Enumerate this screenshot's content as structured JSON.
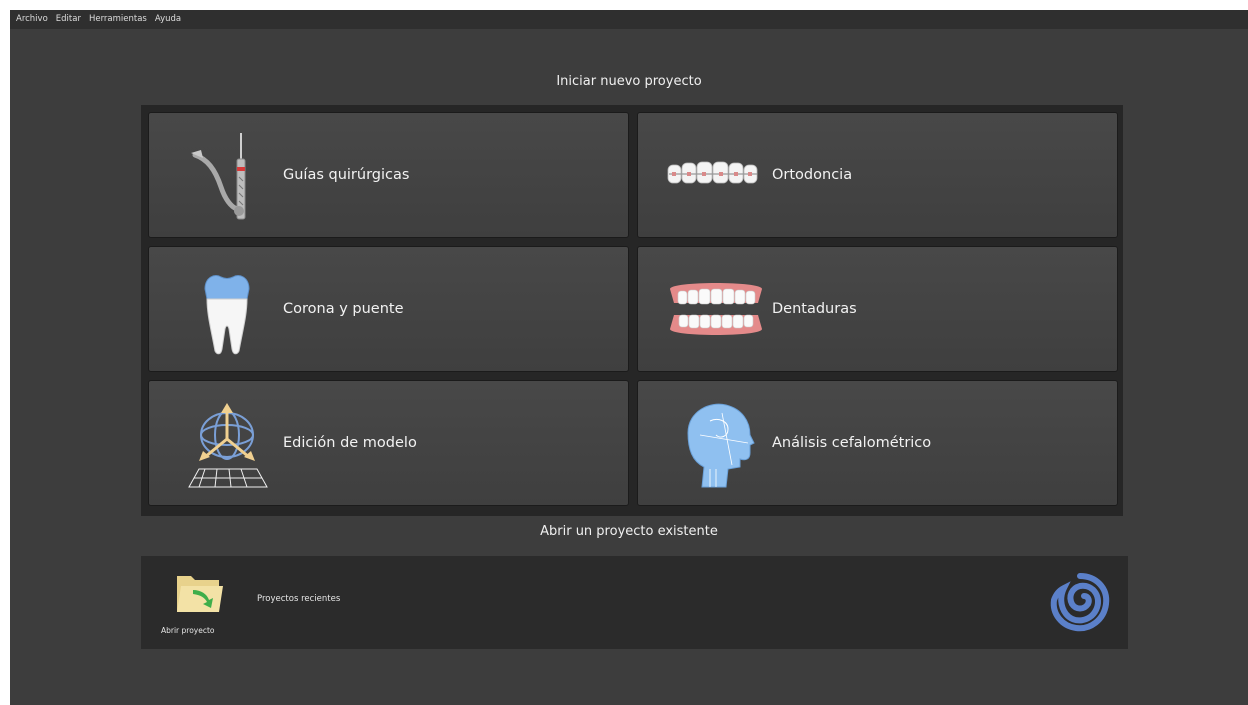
{
  "menubar": {
    "items": [
      "Archivo",
      "Editar",
      "Herramientas",
      "Ayuda"
    ]
  },
  "new_project": {
    "title": "Iniciar nuevo proyecto",
    "tiles": [
      {
        "label": "Guías quirúrgicas",
        "icon": "surgical-guide-icon"
      },
      {
        "label": "Ortodoncia",
        "icon": "braces-icon"
      },
      {
        "label": "Corona y puente",
        "icon": "tooth-crown-icon"
      },
      {
        "label": "Dentaduras",
        "icon": "denture-icon"
      },
      {
        "label": "Edición de modelo",
        "icon": "model-edit-gizmo-icon"
      },
      {
        "label": "Análisis cefalométrico",
        "icon": "head-profile-icon"
      }
    ]
  },
  "open_project": {
    "title": "Abrir un proyecto existente",
    "open_label": "Abrir proyecto",
    "recent_label": "Proyectos recientes",
    "icons": [
      "folder-open-icon",
      "brand-logo-icon"
    ]
  },
  "colors": {
    "background": "#3d3d3d",
    "panel": "#262626",
    "tile": "#454545",
    "accent_blue": "#6f9fe0",
    "logo_blue": "#5b80c9"
  }
}
